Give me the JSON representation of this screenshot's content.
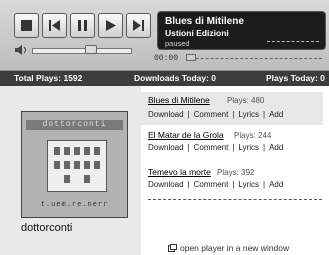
{
  "player": {
    "track_title": "Blues di Mitilene",
    "artist": "Ustioni Edizioni",
    "status": "paused",
    "time": "00:00"
  },
  "stats": {
    "total_plays_label": "Total Plays: 1592",
    "downloads_today_label": "Downloads Today: 0",
    "plays_today_label": "Plays Today: 0"
  },
  "album": {
    "cover_title": "dottorconti",
    "cover_foot": "t.uem.re.nerr"
  },
  "username": "dottorconti",
  "tracks": [
    {
      "name": "Blues di Mitilene",
      "plays": "Plays: 480"
    },
    {
      "name": "El Matar de la Grola",
      "plays": "Plays: 244"
    },
    {
      "name": "Temevo la morte",
      "plays": "Plays: 392"
    }
  ],
  "actions": {
    "download": "Download",
    "comment": "Comment",
    "lyrics": "Lyrics",
    "add": "Add",
    "sep": "|"
  },
  "open_new_window": "open player in a new window",
  "icons": [
    "stop-icon",
    "previous-icon",
    "pause-icon",
    "play-icon",
    "next-icon",
    "volume-icon",
    "new-window-icon"
  ]
}
